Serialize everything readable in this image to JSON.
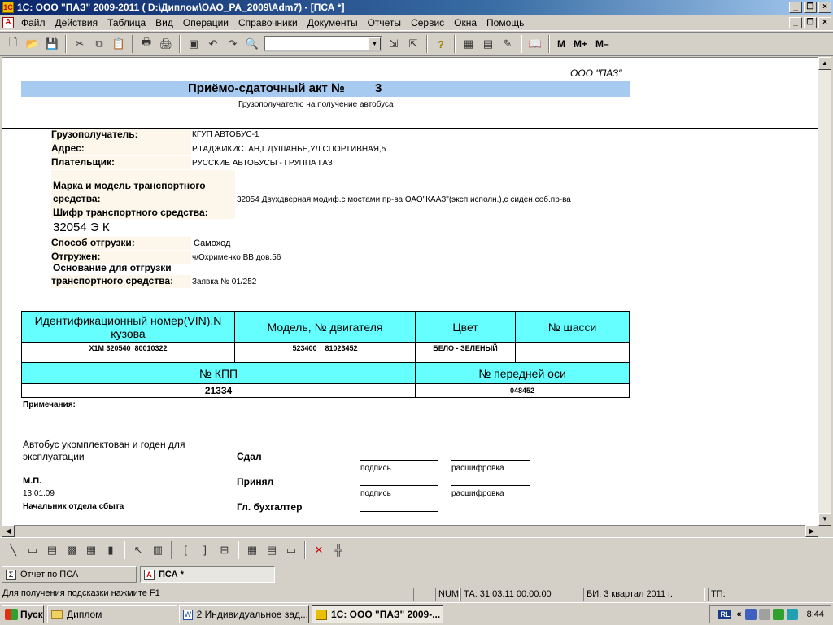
{
  "window": {
    "title": "1С: ООО \"ПАЗ\"  2009-2011 ( D:\\Диплом\\ОАО_РА_2009\\Adm7) - [ПСА  *]",
    "buttons": {
      "minimize": "_",
      "restore": "❐",
      "close": "×"
    }
  },
  "menu": [
    "Файл",
    "Действия",
    "Таблица",
    "Вид",
    "Операции",
    "Справочники",
    "Документы",
    "Отчеты",
    "Сервис",
    "Окна",
    "Помощь"
  ],
  "toolbar": {
    "combo_value": "",
    "memory_buttons": [
      "M",
      "M+",
      "M–"
    ]
  },
  "document": {
    "company": "ООО \"ПАЗ\"",
    "title": "Приёмо-сдаточный акт №",
    "number": "3",
    "subtitle": "Грузополучателю на получение автобуса",
    "fields": {
      "consignee_label": "Грузополучатель:",
      "consignee_value": "КГУП АВТОБУС-1",
      "address_label": "Адрес:",
      "address_value": "Р.ТАДЖИКИСТАН,Г.ДУШАНБЕ,УЛ.СПОРТИВНАЯ,5",
      "payer_label": "Плательщик:",
      "payer_value": "РУССКИЕ АВТОБУСЫ - ГРУППА ГАЗ",
      "model_label_1": "Марка и модель транспортного",
      "model_label_2": "средства:",
      "model_value": "32054 Двухдверная модиф.с мостами пр-ва ОАО\"КААЗ\"(эксп.исполн.),с сиден.соб.пр-ва",
      "code_label": "Шифр транспортного средства:",
      "code_value": "32054 Э К",
      "shipment_label": "Способ отгрузки:",
      "shipment_value": "Самоход",
      "shipped_label": "Отгружен:",
      "shipped_value": "ч/Охрименко ВВ дов.56",
      "basis_label_1": "Основание для отгрузки",
      "basis_label_2": "транспортного средства:",
      "basis_value": "Заявка № 01/252"
    },
    "table": {
      "headers": [
        "Идентификационный номер(VIN),N кузова",
        "Модель, № двигателя",
        "Цвет",
        "№ шасси"
      ],
      "row": [
        "X1M 320540  80010322",
        "523400    81023452",
        "БЕЛО - ЗЕЛЕНЫЙ",
        ""
      ],
      "headers2": [
        "№ КПП",
        "№ передней оси"
      ],
      "row2": [
        "21334",
        "048452"
      ]
    },
    "notes_label": "Примечания:",
    "footer": {
      "fit_text_1": "Автобус укомплектован и годен для",
      "fit_text_2": "эксплуатации",
      "stamp": "М.П.",
      "date": "13.01.09",
      "head": "Начальник отдела сбыта",
      "handed": "Сдал",
      "received": "Принял",
      "accountant": "Гл. бухгалтер",
      "signature": "подпись",
      "decode": "расшифровка"
    }
  },
  "window_tabs": [
    "Отчет по ПСА",
    "ПСА  *"
  ],
  "status": {
    "hint": "Для получения подсказки нажмите F1",
    "num": "NUM",
    "ta": "ТА: 31.03.11  00:00:00",
    "bi": "БИ: 3 квартал 2011 г.",
    "tp": "ТП:"
  },
  "taskbar": {
    "start": "Пуск",
    "tasks": [
      "Диплом",
      "2 Индивидуальное зад...",
      "1С: ООО \"ПАЗ\"  2009-..."
    ],
    "lang": "RL",
    "clock": "8:44"
  }
}
